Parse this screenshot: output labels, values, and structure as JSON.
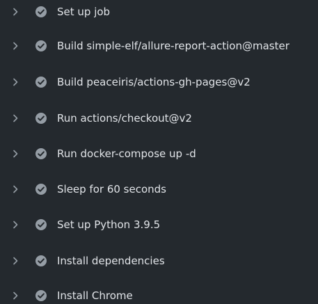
{
  "steps": [
    {
      "label": "Set up job",
      "status": "success"
    },
    {
      "label": "Build simple-elf/allure-report-action@master",
      "status": "success"
    },
    {
      "label": "Build peaceiris/actions-gh-pages@v2",
      "status": "success"
    },
    {
      "label": "Run actions/checkout@v2",
      "status": "success"
    },
    {
      "label": "Run docker-compose up -d",
      "status": "success"
    },
    {
      "label": "Sleep for 60 seconds",
      "status": "success"
    },
    {
      "label": "Set up Python 3.9.5",
      "status": "success"
    },
    {
      "label": "Install dependencies",
      "status": "success"
    },
    {
      "label": "Install Chrome",
      "status": "success"
    }
  ],
  "icons": {
    "expand": "chevron-right-icon",
    "status": "check-circle-icon"
  },
  "colors": {
    "background": "#24292e",
    "text": "#e1e4e8",
    "icon": "#959da5",
    "chevron": "#959da5"
  }
}
